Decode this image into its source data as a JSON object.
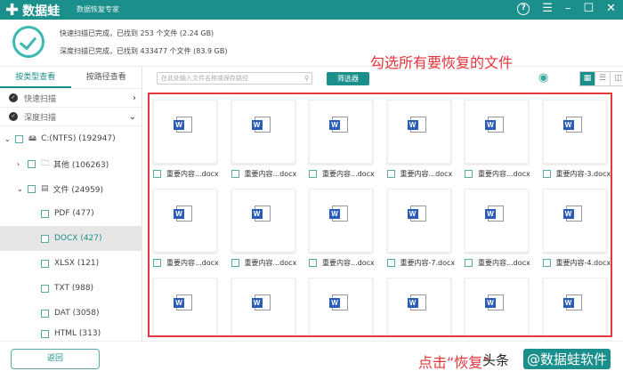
{
  "app": {
    "name": "数据蛙",
    "subtitle": "数据恢复专家"
  },
  "header": {
    "quick": "快速扫描已完成，已找到  253  个文件  (2.24 GB)",
    "deep": "深度扫描已完成，已找到  433477  个文件  (83.9 GB)"
  },
  "left": {
    "tabs": [
      "按类型查看",
      "按路径查看"
    ],
    "quick_scan": "快速扫描",
    "deep_scan": "深度扫描",
    "tree": [
      {
        "label": "C:(NTFS) (192947)"
      },
      {
        "label": "其他 (106263)"
      },
      {
        "label": "文件 (24959)"
      },
      {
        "label": "PDF (477)"
      },
      {
        "label": "DOCX (427)"
      },
      {
        "label": "XLSX (121)"
      },
      {
        "label": "TXT (988)"
      },
      {
        "label": "DAT (3058)"
      },
      {
        "label": "HTML (313)"
      }
    ]
  },
  "toolbar": {
    "search_placeholder": "在此处输入文件名称或保存路径",
    "filter": "筛选器"
  },
  "annotation": {
    "top": "勾选所有要恢复的文件",
    "bottom": "点击“恢复”",
    "watermark_at": "头条",
    "watermark": "@数据蛙软件"
  },
  "files": [
    "重要内容...docx",
    "重要内容...docx",
    "重要内容...docx",
    "重要内容...docx",
    "重要内容...docx",
    "重要内容-3.docx",
    "重要内容...docx",
    "重要内容...docx",
    "重要内容...docx",
    "重要内容-7.docx",
    "重要内容...docx",
    "重要内容-4.docx",
    "",
    "",
    "",
    "",
    "",
    ""
  ],
  "footer": {
    "back": "返回"
  }
}
